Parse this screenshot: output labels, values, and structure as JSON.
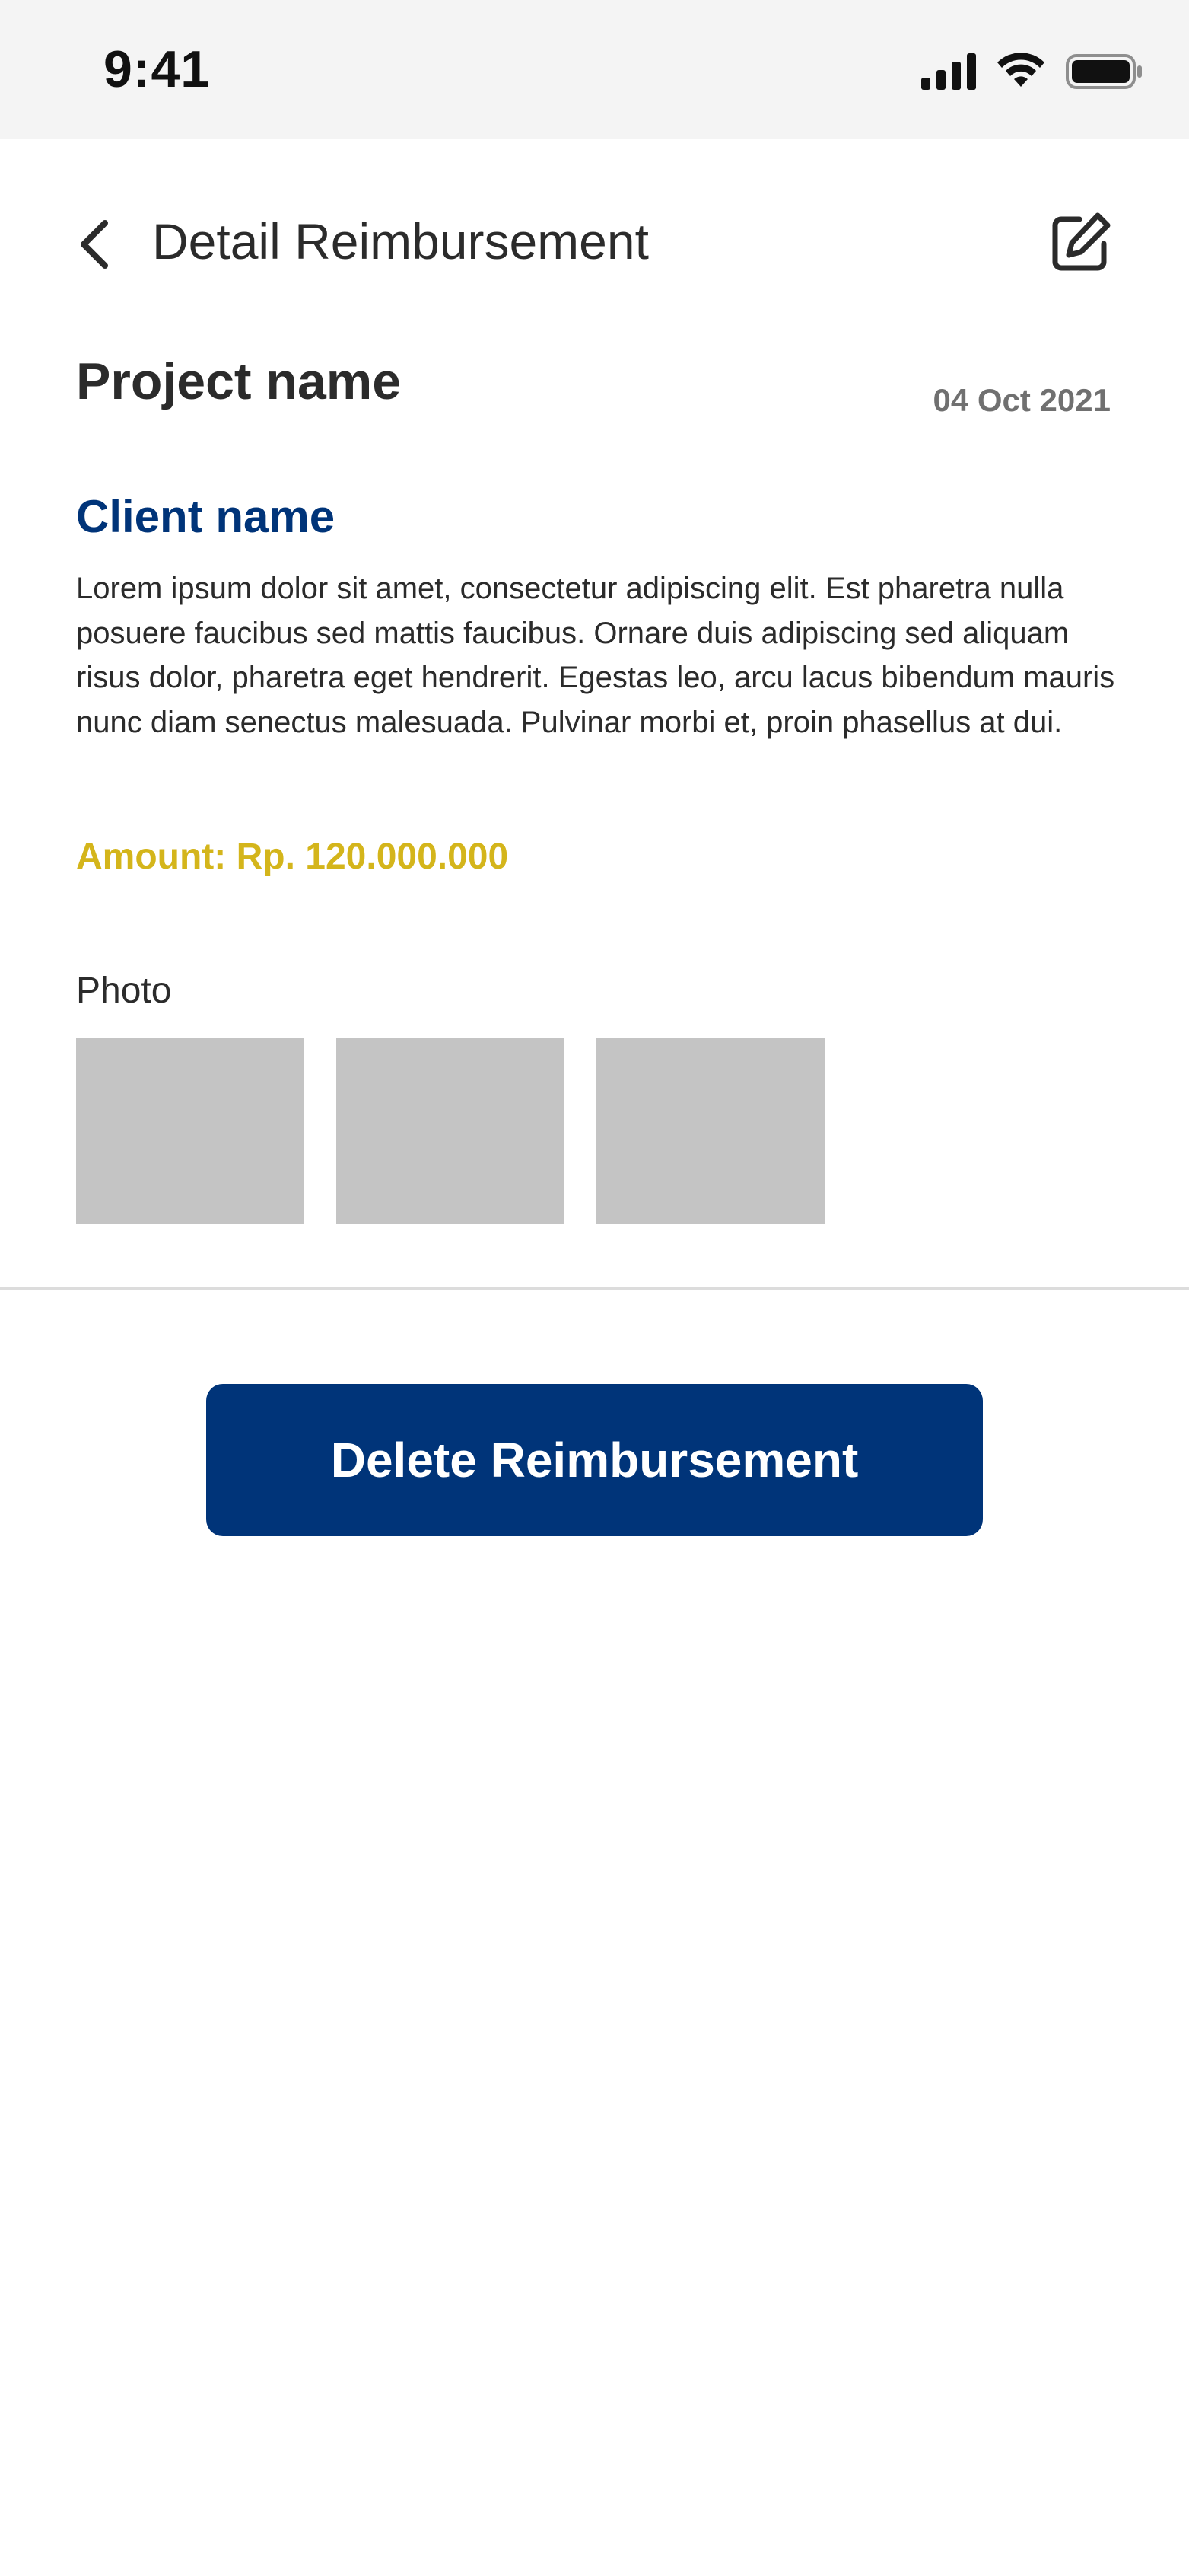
{
  "status_bar": {
    "time": "9:41",
    "icons": [
      "cellular-signal-icon",
      "wifi-icon",
      "battery-icon"
    ]
  },
  "header": {
    "title": "Detail Reimbursement",
    "back_icon": "chevron-left-icon",
    "edit_icon": "edit-icon"
  },
  "reimbursement": {
    "project_name": "Project name",
    "date": "04 Oct 2021",
    "client_name": "Client name",
    "description": "Lorem ipsum dolor sit amet, consectetur adipiscing elit. Est pharetra nulla posuere faucibus sed mattis faucibus. Ornare duis adipiscing sed aliquam risus dolor, pharetra eget hendrerit. Egestas leo, arcu lacus bibendum mauris nunc diam senectus malesuada. Pulvinar morbi et, proin phasellus at dui.",
    "amount": "Amount: Rp. 120.000.000"
  },
  "photos": {
    "label": "Photo"
  },
  "actions": {
    "delete_label": "Delete Reimbursement"
  },
  "colors": {
    "primary": "#003479",
    "amount": "#d4b51b",
    "text": "#2b2b2b",
    "muted": "#707070",
    "placeholder": "#c4c4c4",
    "status_bar_bg": "#f4f4f4"
  }
}
